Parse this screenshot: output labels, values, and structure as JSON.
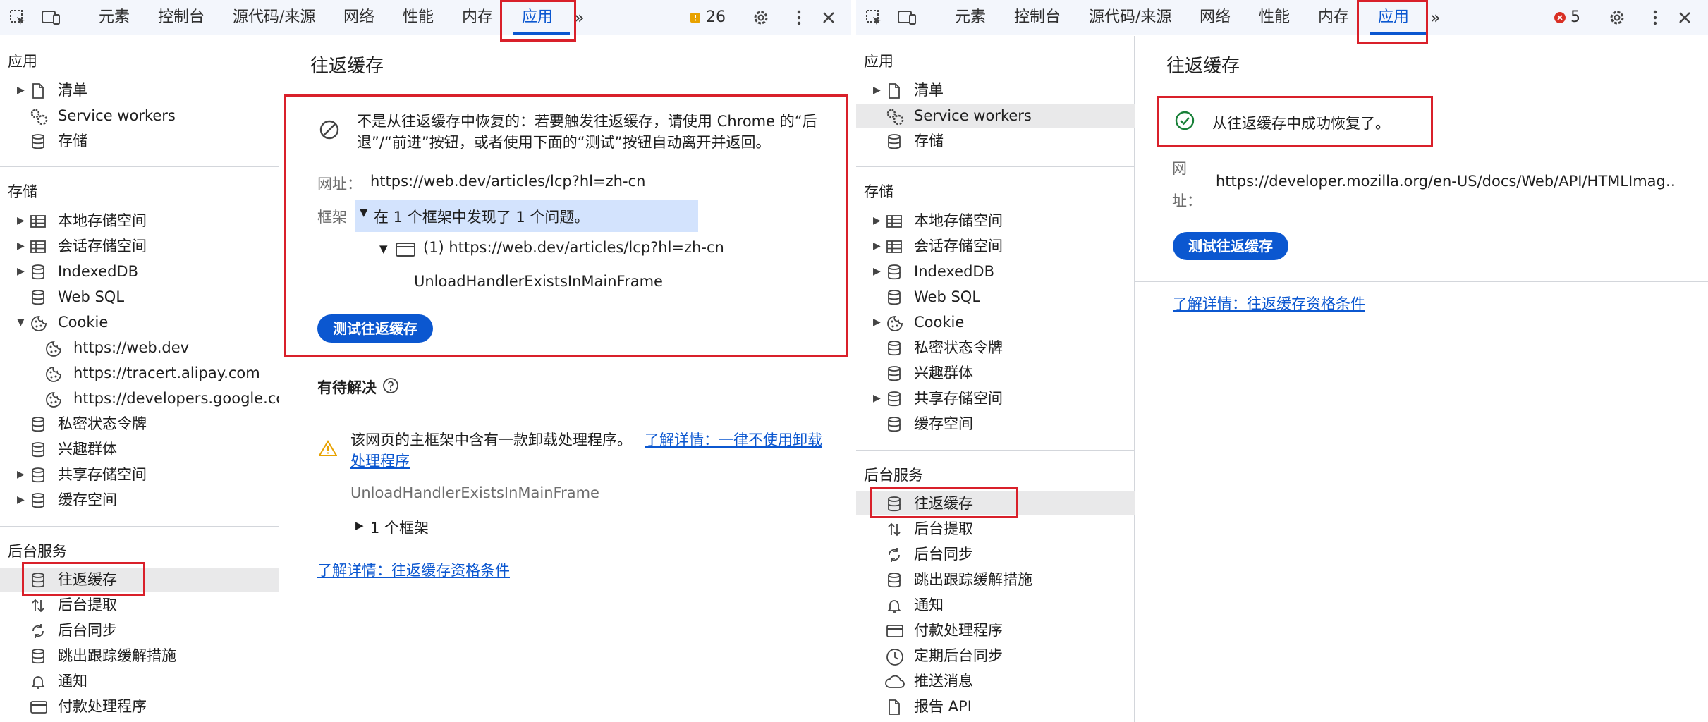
{
  "colors": {
    "accent": "#0b57d0",
    "highlight_red": "#d9202a",
    "success": "#188038",
    "warning": "#e8a200",
    "error": "#d93025"
  },
  "left": {
    "toolbar": {
      "tabs": [
        "元素",
        "控制台",
        "源代码/来源",
        "网络",
        "性能",
        "内存",
        "应用"
      ],
      "active_tab": "应用",
      "warning_count": "26"
    },
    "sidebar": {
      "sections": {
        "app": {
          "title": "应用",
          "items": [
            {
              "label": "清单",
              "icon": "document-icon",
              "expandable": true
            },
            {
              "label": "Service workers",
              "icon": "gears-icon",
              "expandable": false
            },
            {
              "label": "存储",
              "icon": "database-icon",
              "expandable": false
            }
          ]
        },
        "storage": {
          "title": "存储",
          "items": [
            {
              "label": "本地存储空间",
              "icon": "table-icon",
              "expandable": true
            },
            {
              "label": "会话存储空间",
              "icon": "table-icon",
              "expandable": true
            },
            {
              "label": "IndexedDB",
              "icon": "database-icon",
              "expandable": true
            },
            {
              "label": "Web SQL",
              "icon": "database-icon",
              "expandable": false
            },
            {
              "label": "Cookie",
              "icon": "cookie-icon",
              "expandable": true,
              "expanded": true
            },
            {
              "label": "https://web.dev",
              "icon": "cookie-icon",
              "child": true
            },
            {
              "label": "https://tracert.alipay.com",
              "icon": "cookie-icon",
              "child": true
            },
            {
              "label": "https://developers.google.com",
              "icon": "cookie-icon",
              "child": true
            },
            {
              "label": "私密状态令牌",
              "icon": "database-icon",
              "expandable": false
            },
            {
              "label": "兴趣群体",
              "icon": "database-icon",
              "expandable": false
            },
            {
              "label": "共享存储空间",
              "icon": "database-icon",
              "expandable": true
            },
            {
              "label": "缓存空间",
              "icon": "database-icon",
              "expandable": true
            }
          ]
        },
        "background": {
          "title": "后台服务",
          "items": [
            {
              "label": "往返缓存",
              "icon": "database-icon",
              "selected": true
            },
            {
              "label": "后台提取",
              "icon": "up-down-arrows-icon"
            },
            {
              "label": "后台同步",
              "icon": "sync-icon"
            },
            {
              "label": "跳出跟踪缓解措施",
              "icon": "database-icon"
            },
            {
              "label": "通知",
              "icon": "bell-icon"
            },
            {
              "label": "付款处理程序",
              "icon": "card-icon"
            }
          ]
        }
      }
    },
    "main": {
      "title": "往返缓存",
      "status_text_line1": "不是从往返缓存中恢复的：若要触发往返缓存，请使用 Chrome 的“后",
      "status_text_line2": "退”/“前进”按钮，或者使用下面的“测试”按钮自动离开并返回。",
      "url_label": "网址：",
      "url_value": "https://web.dev/articles/lcp?hl=zh-cn",
      "frames_label": "框架",
      "frames_summary": "在 1 个框架中发现了 1 个问题。",
      "frame_entry": "(1) https://web.dev/articles/lcp?hl=zh-cn",
      "frame_reason": "UnloadHandlerExistsInMainFrame",
      "test_button": "测试往返缓存",
      "pending_title": "有待解决",
      "issue_text_line1": "该网页的主框架中含有一款卸载处理程序。",
      "issue_link_line1": "了解详情：一律不使用卸载",
      "issue_link_line2": "处理程序",
      "issue_reason": "UnloadHandlerExistsInMainFrame",
      "frames_count": "1 个框架",
      "learn_more": "了解详情：往返缓存资格条件"
    }
  },
  "right": {
    "toolbar": {
      "tabs": [
        "元素",
        "控制台",
        "源代码/来源",
        "网络",
        "性能",
        "内存",
        "应用"
      ],
      "active_tab": "应用",
      "error_count": "5"
    },
    "sidebar": {
      "sections": {
        "app": {
          "title": "应用",
          "items": [
            {
              "label": "清单",
              "icon": "document-icon",
              "expandable": true
            },
            {
              "label": "Service workers",
              "icon": "gears-icon",
              "selected_hover": true
            },
            {
              "label": "存储",
              "icon": "database-icon"
            }
          ]
        },
        "storage": {
          "title": "存储",
          "items": [
            {
              "label": "本地存储空间",
              "icon": "table-icon",
              "expandable": true
            },
            {
              "label": "会话存储空间",
              "icon": "table-icon",
              "expandable": true
            },
            {
              "label": "IndexedDB",
              "icon": "database-icon",
              "expandable": true
            },
            {
              "label": "Web SQL",
              "icon": "database-icon"
            },
            {
              "label": "Cookie",
              "icon": "cookie-icon",
              "expandable": true
            },
            {
              "label": "私密状态令牌",
              "icon": "database-icon"
            },
            {
              "label": "兴趣群体",
              "icon": "database-icon"
            },
            {
              "label": "共享存储空间",
              "icon": "database-icon",
              "expandable": true
            },
            {
              "label": "缓存空间",
              "icon": "database-icon"
            }
          ]
        },
        "background": {
          "title": "后台服务",
          "items": [
            {
              "label": "往返缓存",
              "icon": "database-icon",
              "selected": true
            },
            {
              "label": "后台提取",
              "icon": "up-down-arrows-icon"
            },
            {
              "label": "后台同步",
              "icon": "sync-icon"
            },
            {
              "label": "跳出跟踪缓解措施",
              "icon": "database-icon"
            },
            {
              "label": "通知",
              "icon": "bell-icon"
            },
            {
              "label": "付款处理程序",
              "icon": "card-icon"
            },
            {
              "label": "定期后台同步",
              "icon": "clock-icon"
            },
            {
              "label": "推送消息",
              "icon": "cloud-icon"
            },
            {
              "label": "报告 API",
              "icon": "document-icon"
            }
          ]
        }
      }
    },
    "main": {
      "title": "往返缓存",
      "status_text": "从往返缓存中成功恢复了。",
      "url_label_1": "网",
      "url_label_2": "址：",
      "url_value": "https://developer.mozilla.org/en-US/docs/Web/API/HTMLImag…",
      "test_button": "测试往返缓存",
      "learn_more": "了解详情：往返缓存资格条件"
    }
  }
}
